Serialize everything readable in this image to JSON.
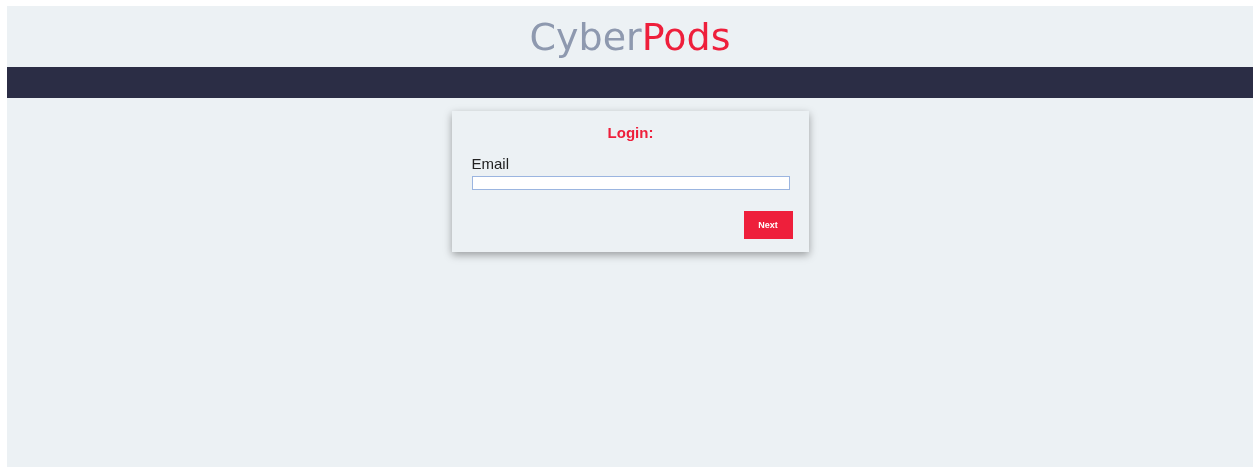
{
  "logo": {
    "parts": [
      {
        "text": "Cyber",
        "color": "#8e99af"
      },
      {
        "text": "Pods",
        "color": "#ee1f3b"
      }
    ]
  },
  "login": {
    "title": "Login:",
    "field_label": "Email",
    "button": "Next"
  }
}
